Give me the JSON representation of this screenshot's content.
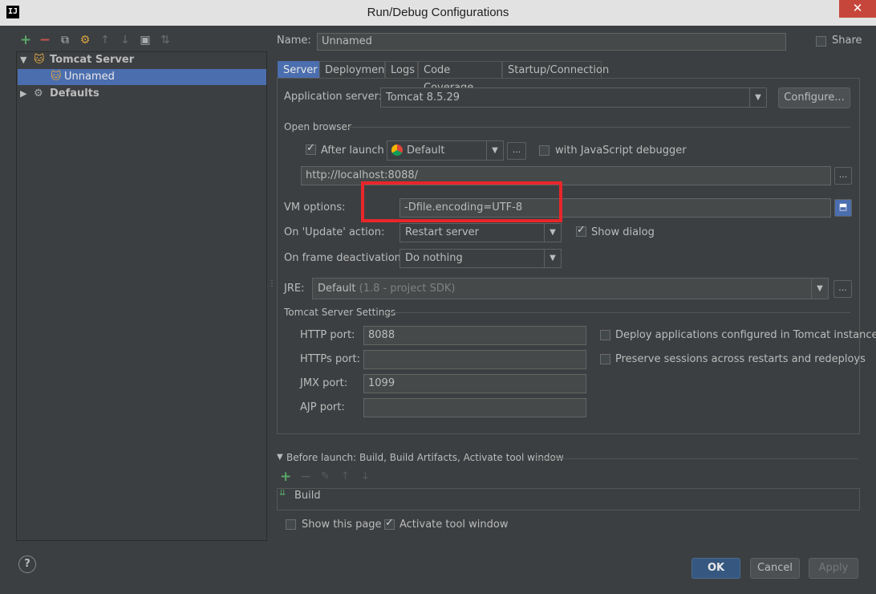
{
  "window": {
    "title": "Run/Debug Configurations",
    "app_icon": "IJ",
    "close_glyph": "✕"
  },
  "left_toolbar": {
    "icons": [
      "+",
      "−",
      "⧉",
      "⚙",
      "↑",
      "↓",
      "▣",
      "⇅"
    ]
  },
  "tree": {
    "tomcat_server": "Tomcat Server",
    "unnamed": "Unnamed",
    "defaults": "Defaults"
  },
  "name_row": {
    "label": "Name:",
    "value": "Unnamed",
    "share_label": "Share"
  },
  "tabs": [
    "Server",
    "Deployment",
    "Logs",
    "Code Coverage",
    "Startup/Connection"
  ],
  "server": {
    "app_server_label": "Application server:",
    "app_server_value": "Tomcat 8.5.29",
    "configure_button": "Configure...",
    "open_browser_label": "Open browser",
    "after_launch_label": "After launch",
    "browser_value": "Default",
    "js_debugger_label": "with JavaScript debugger",
    "url_value": "http://localhost:8088/",
    "vm_options_label": "VM options:",
    "vm_options_value": "-Dfile.encoding=UTF-8",
    "on_update_label": "On 'Update' action:",
    "on_update_value": "Restart server",
    "show_dialog_label": "Show dialog",
    "on_frame_label": "On frame deactivation:",
    "on_frame_value": "Do nothing",
    "jre_label": "JRE:",
    "jre_value": "Default",
    "jre_hint": "(1.8 - project SDK)",
    "tomcat_settings_label": "Tomcat Server Settings",
    "http_port_label": "HTTP port:",
    "http_port_value": "8088",
    "https_port_label": "HTTPs port:",
    "https_port_value": "",
    "jmx_port_label": "JMX port:",
    "jmx_port_value": "1099",
    "ajp_port_label": "AJP port:",
    "ajp_port_value": "",
    "deploy_apps_label": "Deploy applications configured in Tomcat instance",
    "preserve_sessions_label": "Preserve sessions across restarts and redeploys",
    "ellipsis": "..."
  },
  "before_launch": {
    "header": "Before launch: Build, Build Artifacts, Activate tool window",
    "items": [
      "Build"
    ]
  },
  "bottom": {
    "show_page_label": "Show this page",
    "activate_tool_label": "Activate tool window",
    "ok": "OK",
    "cancel": "Cancel",
    "apply": "Apply",
    "help": "?"
  },
  "colors": {
    "background": "#3c3f41",
    "selection": "#4b6eaf",
    "highlight_box": "#e8262b",
    "add_green": "#59a869",
    "remove_red": "#c75450"
  }
}
